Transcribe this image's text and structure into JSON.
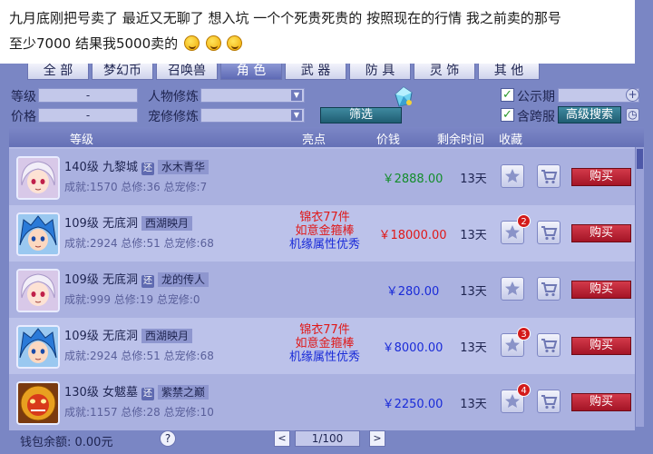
{
  "caption": {
    "line1": "九月底刚把号卖了 最近又无聊了 想入坑 一个个死贵死贵的 按照现在的行情 我之前卖的那号",
    "line2": "至少7000 结果我5000卖的"
  },
  "tabs": [
    "全  部",
    "梦幻币",
    "召唤兽",
    "角  色",
    "武  器",
    "防  具",
    "灵  饰",
    "其  他"
  ],
  "active_tab_index": 3,
  "filters": {
    "level_label": "等级",
    "level_value": "-",
    "price_label": "价格",
    "price_value": "-",
    "char_cultivation_label": "人物修炼",
    "pet_cultivation_label": "宠修修炼",
    "filter_button": "筛选",
    "public_period_label": "公示期",
    "cross_server_label": "含跨服",
    "advanced_search_button": "高级搜索"
  },
  "table": {
    "headers": {
      "level": "等级",
      "highlights": "亮点",
      "price": "价钱",
      "remaining": "剩余时间",
      "favorite": "收藏"
    },
    "rows": [
      {
        "title": "140级 九黎城",
        "tag": "还",
        "server": "水木青华",
        "stats": "成就:1570 总修:36 总宠修:7",
        "highlights": [],
        "price": "￥2888.00",
        "price_color": "green",
        "remaining": "13天",
        "fav_count": "",
        "buy": "购买",
        "avatar": "white-hair-girl"
      },
      {
        "title": "109级 无底洞",
        "tag": "",
        "server": "西湖映月",
        "stats": "成就:2924 总修:51 总宠修:68",
        "highlights": [
          {
            "text": "锦衣77件",
            "color": "red"
          },
          {
            "text": "如意金箍棒",
            "color": "red"
          },
          {
            "text": "机缘属性优秀",
            "color": "blue"
          }
        ],
        "price": "￥18000.00",
        "price_color": "red",
        "remaining": "13天",
        "fav_count": "2",
        "buy": "购买",
        "avatar": "blue-hair-boy"
      },
      {
        "title": "109级 无底洞",
        "tag": "还",
        "server": "龙的传人",
        "stats": "成就:999 总修:19 总宠修:0",
        "highlights": [],
        "price": "￥280.00",
        "price_color": "blue",
        "remaining": "13天",
        "fav_count": "",
        "buy": "购买",
        "avatar": "white-hair-girl"
      },
      {
        "title": "109级 无底洞",
        "tag": "",
        "server": "西湖映月",
        "stats": "成就:2924 总修:51 总宠修:68",
        "highlights": [
          {
            "text": "锦衣77件",
            "color": "red"
          },
          {
            "text": "如意金箍棒",
            "color": "red"
          },
          {
            "text": "机缘属性优秀",
            "color": "blue"
          }
        ],
        "price": "￥8000.00",
        "price_color": "blue",
        "remaining": "13天",
        "fav_count": "3",
        "buy": "购买",
        "avatar": "blue-hair-boy"
      },
      {
        "title": "130级 女魃墓",
        "tag": "还",
        "server": "紫禁之巅",
        "stats": "成就:1157 总修:28 总宠修:10",
        "highlights": [],
        "price": "￥2250.00",
        "price_color": "blue",
        "remaining": "13天",
        "fav_count": "4",
        "buy": "购买",
        "avatar": "lion-mask"
      }
    ]
  },
  "footer": {
    "wallet": "钱包余额: 0.00元",
    "help": "?",
    "page": "1/100",
    "prev": "<",
    "next": ">"
  }
}
